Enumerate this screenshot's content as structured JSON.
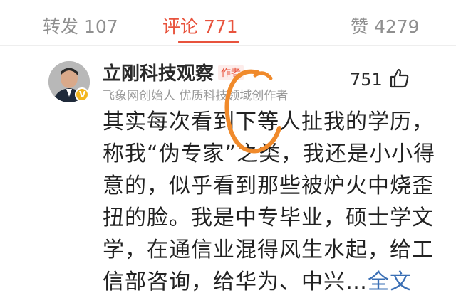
{
  "tabs": {
    "repost": "转发 107",
    "comment": "评论 771",
    "like": "赞 4279"
  },
  "comment": {
    "username": "立刚科技观察",
    "author_tag": "作者",
    "description": "飞象网创始人 优质科技领域创作者",
    "like_count": "751",
    "lines": [
      "其实每次看到下等人扯我的学历，",
      "称我“伪专家”之类，我还是小小得",
      "意的，似乎看到那些被炉火中烧歪",
      "扭的脸。我是中专毕业，硕士学文",
      "学，在通信业混得风生水起，给工",
      "信部咨询，给华为、中兴…"
    ],
    "expand_label": "全文"
  },
  "colors": {
    "accent": "#e8533d",
    "link": "#3a6fb5",
    "annotation": "#f08a2b"
  }
}
